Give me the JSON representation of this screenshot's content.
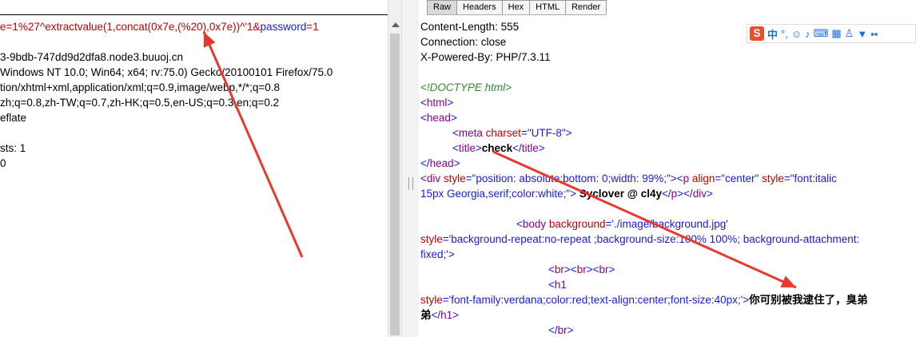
{
  "request": {
    "lines": [
      {
        "segments": [
          {
            "t": "e=1%27^extractvalue(1,concat(0x7e,(%20),0x7e))^'1&",
            "c": "red"
          },
          {
            "t": "password",
            "c": "blue"
          },
          {
            "t": "=1",
            "c": "red"
          }
        ]
      },
      {
        "segments": [
          {
            "t": "",
            "c": "black"
          }
        ]
      },
      {
        "segments": [
          {
            "t": "3-9bdb-747dd9d2dfa8.node3.buuoj.cn",
            "c": "black"
          }
        ]
      },
      {
        "segments": [
          {
            "t": "Windows NT 10.0; Win64; x64; rv:75.0) Gecko/20100101 Firefox/75.0",
            "c": "black"
          }
        ]
      },
      {
        "segments": [
          {
            "t": "tion/xhtml+xml,application/xml;q=0.9,image/webp,*/*;q=0.8",
            "c": "black"
          }
        ]
      },
      {
        "segments": [
          {
            "t": "zh;q=0.8,zh-TW;q=0.7,zh-HK;q=0.5,en-US;q=0.3,en;q=0.2",
            "c": "black"
          }
        ]
      },
      {
        "segments": [
          {
            "t": "eflate",
            "c": "black"
          }
        ]
      },
      {
        "segments": [
          {
            "t": "",
            "c": "black"
          }
        ]
      },
      {
        "segments": [
          {
            "t": "sts: 1",
            "c": "black"
          }
        ]
      },
      {
        "segments": [
          {
            "t": "0",
            "c": "black"
          }
        ]
      }
    ]
  },
  "response": {
    "tabs": [
      "Raw",
      "Headers",
      "Hex",
      "HTML",
      "Render"
    ],
    "active_tab": "Raw",
    "lines": [
      {
        "indent": 0,
        "segments": [
          {
            "t": "Content-Length: 555",
            "c": "black"
          }
        ]
      },
      {
        "indent": 0,
        "segments": [
          {
            "t": "Connection: close",
            "c": "black"
          }
        ]
      },
      {
        "indent": 0,
        "segments": [
          {
            "t": "X-Powered-By: PHP/7.3.11",
            "c": "black"
          }
        ]
      },
      {
        "indent": 0,
        "segments": [
          {
            "t": "",
            "c": "black"
          }
        ]
      },
      {
        "indent": 0,
        "segments": [
          {
            "t": "<!DOCTYPE html>",
            "c": "green"
          }
        ]
      },
      {
        "indent": 0,
        "segments": [
          {
            "t": "<",
            "c": "blue"
          },
          {
            "t": "html",
            "c": "purple"
          },
          {
            "t": ">",
            "c": "blue"
          }
        ]
      },
      {
        "indent": 0,
        "segments": [
          {
            "t": "<",
            "c": "blue"
          },
          {
            "t": "head",
            "c": "purple"
          },
          {
            "t": ">",
            "c": "blue"
          }
        ]
      },
      {
        "indent": 40,
        "segments": [
          {
            "t": "<",
            "c": "blue"
          },
          {
            "t": "meta ",
            "c": "purple"
          },
          {
            "t": "charset",
            "c": "red"
          },
          {
            "t": "=\"UTF-8\">",
            "c": "blue"
          }
        ]
      },
      {
        "indent": 40,
        "segments": [
          {
            "t": "<",
            "c": "blue"
          },
          {
            "t": "title",
            "c": "purple"
          },
          {
            "t": ">",
            "c": "blue"
          },
          {
            "t": "check",
            "c": "black bold"
          },
          {
            "t": "</",
            "c": "blue"
          },
          {
            "t": "title",
            "c": "purple"
          },
          {
            "t": ">",
            "c": "blue"
          }
        ]
      },
      {
        "indent": 0,
        "segments": [
          {
            "t": "</",
            "c": "blue"
          },
          {
            "t": "head",
            "c": "purple"
          },
          {
            "t": ">",
            "c": "blue"
          }
        ]
      },
      {
        "indent": 0,
        "segments": [
          {
            "t": "<",
            "c": "blue"
          },
          {
            "t": "div ",
            "c": "purple"
          },
          {
            "t": "style",
            "c": "red"
          },
          {
            "t": "=\"position: absolute;bottom: 0;width: 99%;\"><",
            "c": "blue"
          },
          {
            "t": "p ",
            "c": "purple"
          },
          {
            "t": "align",
            "c": "red"
          },
          {
            "t": "=\"center\" ",
            "c": "blue"
          },
          {
            "t": "style",
            "c": "red"
          },
          {
            "t": "=\"font:italic",
            "c": "blue"
          }
        ]
      },
      {
        "indent": 0,
        "segments": [
          {
            "t": "15px Georgia,serif;color:white;\">",
            "c": "blue"
          },
          {
            "t": " Syclover @ cl4y",
            "c": "black bold"
          },
          {
            "t": "</",
            "c": "blue"
          },
          {
            "t": "p",
            "c": "purple"
          },
          {
            "t": "></",
            "c": "blue"
          },
          {
            "t": "div",
            "c": "purple"
          },
          {
            "t": ">",
            "c": "blue"
          }
        ]
      },
      {
        "indent": 0,
        "segments": [
          {
            "t": "",
            "c": "black"
          }
        ]
      },
      {
        "indent": 120,
        "segments": [
          {
            "t": "<",
            "c": "blue"
          },
          {
            "t": "body ",
            "c": "purple"
          },
          {
            "t": "background",
            "c": "red"
          },
          {
            "t": "='./image/background.jpg'",
            "c": "blue"
          }
        ]
      },
      {
        "indent": 0,
        "segments": [
          {
            "t": "style",
            "c": "red"
          },
          {
            "t": "='background-repeat:no-repeat ;background-size:100% 100%; background-attachment:",
            "c": "blue"
          }
        ]
      },
      {
        "indent": 0,
        "segments": [
          {
            "t": "fixed;'>",
            "c": "blue"
          }
        ]
      },
      {
        "indent": 160,
        "segments": [
          {
            "t": "<",
            "c": "blue"
          },
          {
            "t": "br",
            "c": "purple"
          },
          {
            "t": "><",
            "c": "blue"
          },
          {
            "t": "br",
            "c": "purple"
          },
          {
            "t": "><",
            "c": "blue"
          },
          {
            "t": "br",
            "c": "purple"
          },
          {
            "t": ">",
            "c": "blue"
          }
        ]
      },
      {
        "indent": 160,
        "segments": [
          {
            "t": "<",
            "c": "blue"
          },
          {
            "t": "h1",
            "c": "purple"
          }
        ]
      },
      {
        "indent": 0,
        "segments": [
          {
            "t": "style",
            "c": "red"
          },
          {
            "t": "='font-family:verdana;color:red;text-align:center;font-size:40px;'>",
            "c": "blue"
          },
          {
            "t": "你可别被我逮住了，臭弟",
            "c": "black bold"
          }
        ]
      },
      {
        "indent": 0,
        "segments": [
          {
            "t": "弟",
            "c": "black bold"
          },
          {
            "t": "</",
            "c": "blue"
          },
          {
            "t": "h1",
            "c": "purple"
          },
          {
            "t": ">",
            "c": "blue"
          }
        ]
      },
      {
        "indent": 160,
        "segments": [
          {
            "t": "</",
            "c": "blue"
          },
          {
            "t": "br",
            "c": "purple"
          },
          {
            "t": ">",
            "c": "blue"
          }
        ]
      }
    ]
  },
  "ime_toolbar": {
    "logo": "S",
    "label": "中",
    "icons": [
      "punctuation-icon",
      "emoji-icon",
      "microphone-icon",
      "keyboard-icon",
      "grid-icon",
      "person-icon",
      "shirt-icon",
      "apps-icon"
    ]
  },
  "colors": {
    "arrow": "#e8392f",
    "accent": "#c00000"
  }
}
